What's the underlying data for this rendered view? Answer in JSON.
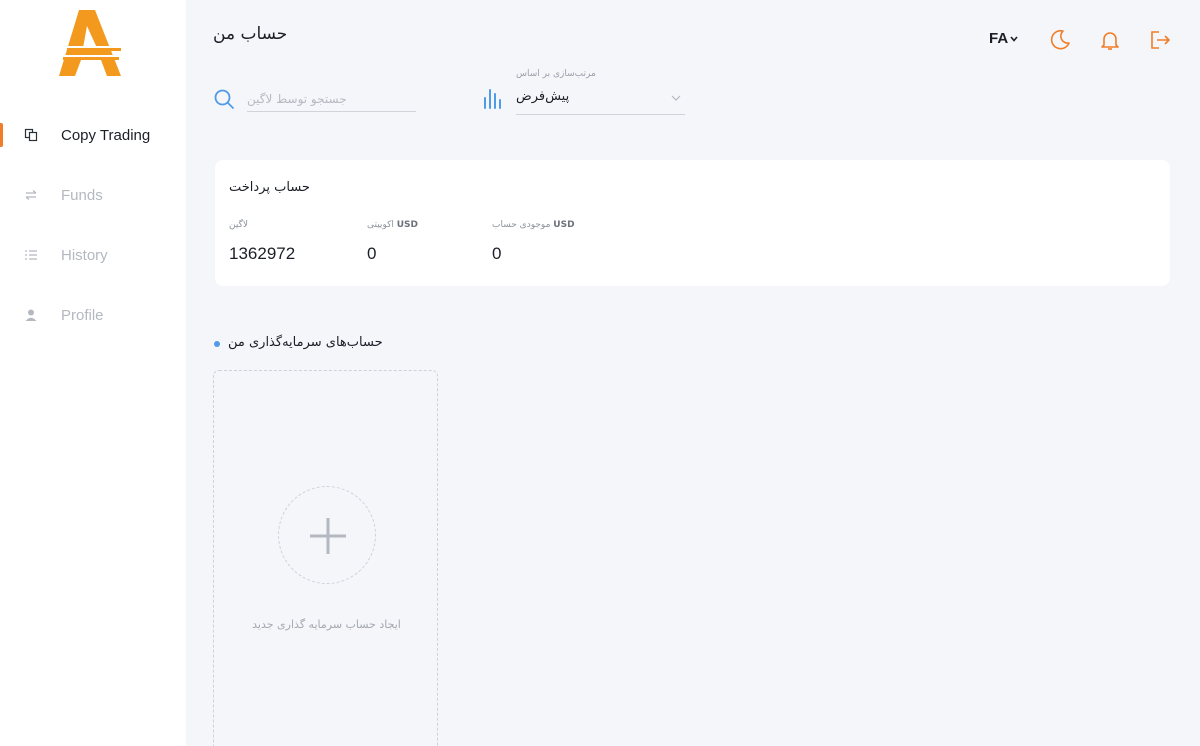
{
  "sidebar": {
    "items": [
      {
        "label": "Copy Trading",
        "icon": "copy-icon",
        "active": true
      },
      {
        "label": "Funds",
        "icon": "transfer-icon",
        "active": false
      },
      {
        "label": "History",
        "icon": "list-icon",
        "active": false
      },
      {
        "label": "Profile",
        "icon": "user-icon",
        "active": false
      }
    ]
  },
  "header": {
    "title": "حساب من",
    "language": "FA",
    "icons": [
      "moon-icon",
      "bell-icon",
      "logout-icon"
    ]
  },
  "search": {
    "placeholder": "جستجو توسط لاگین",
    "value": ""
  },
  "sort": {
    "label": "مرتب‌سازی بر اساس",
    "value": "پیش‌فرض"
  },
  "payment_account": {
    "title": "حساب پرداخت",
    "login_label": "لاگین",
    "login_value": "1362972",
    "equity_label": "اکوییتی",
    "equity_unit": "USD",
    "equity_value": "0",
    "balance_label": "موجودی حساب",
    "balance_unit": "USD",
    "balance_value": "0"
  },
  "investment_section": {
    "title": "حساب‌های سرمایه‌گذاری من",
    "new_account_label": "ایجاد حساب سرمایه گذاری جدید"
  },
  "colors": {
    "accent": "#f07d28",
    "blue": "#4f9be8",
    "background": "#f4f6fa"
  }
}
